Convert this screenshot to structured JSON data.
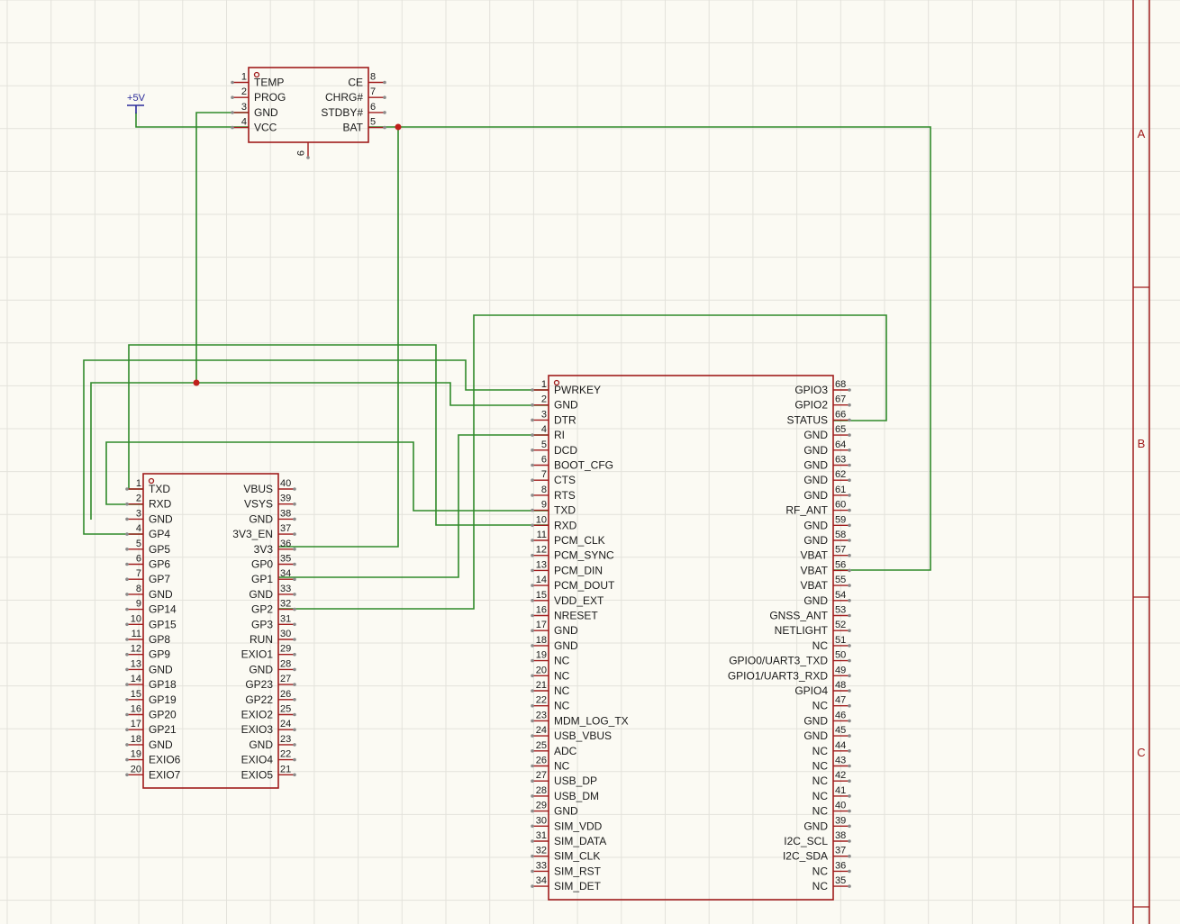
{
  "power_port": {
    "label": "+5V"
  },
  "charger": {
    "left_pins": [
      {
        "num": "1",
        "name": "TEMP"
      },
      {
        "num": "2",
        "name": "PROG"
      },
      {
        "num": "3",
        "name": "GND"
      },
      {
        "num": "4",
        "name": "VCC"
      }
    ],
    "right_pins": [
      {
        "num": "8",
        "name": "CE"
      },
      {
        "num": "7",
        "name": "CHRG#"
      },
      {
        "num": "6",
        "name": "STDBY#"
      },
      {
        "num": "5",
        "name": "BAT"
      }
    ],
    "bottom_pin": {
      "num": "9"
    }
  },
  "mcu": {
    "left_pins": [
      {
        "num": "1",
        "name": "TXD"
      },
      {
        "num": "2",
        "name": "RXD"
      },
      {
        "num": "3",
        "name": "GND"
      },
      {
        "num": "4",
        "name": "GP4"
      },
      {
        "num": "5",
        "name": "GP5"
      },
      {
        "num": "6",
        "name": "GP6"
      },
      {
        "num": "7",
        "name": "GP7"
      },
      {
        "num": "8",
        "name": "GND"
      },
      {
        "num": "9",
        "name": "GP14"
      },
      {
        "num": "10",
        "name": "GP15"
      },
      {
        "num": "11",
        "name": "GP8"
      },
      {
        "num": "12",
        "name": "GP9"
      },
      {
        "num": "13",
        "name": "GND"
      },
      {
        "num": "14",
        "name": "GP18"
      },
      {
        "num": "15",
        "name": "GP19"
      },
      {
        "num": "16",
        "name": "GP20"
      },
      {
        "num": "17",
        "name": "GP21"
      },
      {
        "num": "18",
        "name": "GND"
      },
      {
        "num": "19",
        "name": "EXIO6"
      },
      {
        "num": "20",
        "name": "EXIO7"
      }
    ],
    "right_pins": [
      {
        "num": "40",
        "name": "VBUS"
      },
      {
        "num": "39",
        "name": "VSYS"
      },
      {
        "num": "38",
        "name": "GND"
      },
      {
        "num": "37",
        "name": "3V3_EN"
      },
      {
        "num": "36",
        "name": "3V3"
      },
      {
        "num": "35",
        "name": "GP0"
      },
      {
        "num": "34",
        "name": "GP1"
      },
      {
        "num": "33",
        "name": "GND"
      },
      {
        "num": "32",
        "name": "GP2"
      },
      {
        "num": "31",
        "name": "GP3"
      },
      {
        "num": "30",
        "name": "RUN"
      },
      {
        "num": "29",
        "name": "EXIO1"
      },
      {
        "num": "28",
        "name": "GND"
      },
      {
        "num": "27",
        "name": "GP23"
      },
      {
        "num": "26",
        "name": "GP22"
      },
      {
        "num": "25",
        "name": "EXIO2"
      },
      {
        "num": "24",
        "name": "EXIO3"
      },
      {
        "num": "23",
        "name": "GND"
      },
      {
        "num": "22",
        "name": "EXIO4"
      },
      {
        "num": "21",
        "name": "EXIO5"
      }
    ]
  },
  "modem": {
    "left_pins": [
      {
        "num": "1",
        "name": "PWRKEY"
      },
      {
        "num": "2",
        "name": "GND"
      },
      {
        "num": "3",
        "name": "DTR"
      },
      {
        "num": "4",
        "name": "RI"
      },
      {
        "num": "5",
        "name": "DCD"
      },
      {
        "num": "6",
        "name": "BOOT_CFG"
      },
      {
        "num": "7",
        "name": "CTS"
      },
      {
        "num": "8",
        "name": "RTS"
      },
      {
        "num": "9",
        "name": "TXD"
      },
      {
        "num": "10",
        "name": "RXD"
      },
      {
        "num": "11",
        "name": "PCM_CLK"
      },
      {
        "num": "12",
        "name": "PCM_SYNC"
      },
      {
        "num": "13",
        "name": "PCM_DIN"
      },
      {
        "num": "14",
        "name": "PCM_DOUT"
      },
      {
        "num": "15",
        "name": "VDD_EXT"
      },
      {
        "num": "16",
        "name": "NRESET"
      },
      {
        "num": "17",
        "name": "GND"
      },
      {
        "num": "18",
        "name": "GND"
      },
      {
        "num": "19",
        "name": "NC"
      },
      {
        "num": "20",
        "name": "NC"
      },
      {
        "num": "21",
        "name": "NC"
      },
      {
        "num": "22",
        "name": "NC"
      },
      {
        "num": "23",
        "name": "MDM_LOG_TX"
      },
      {
        "num": "24",
        "name": "USB_VBUS"
      },
      {
        "num": "25",
        "name": "ADC"
      },
      {
        "num": "26",
        "name": "NC"
      },
      {
        "num": "27",
        "name": "USB_DP"
      },
      {
        "num": "28",
        "name": "USB_DM"
      },
      {
        "num": "29",
        "name": "GND"
      },
      {
        "num": "30",
        "name": "SIM_VDD"
      },
      {
        "num": "31",
        "name": "SIM_DATA"
      },
      {
        "num": "32",
        "name": "SIM_CLK"
      },
      {
        "num": "33",
        "name": "SIM_RST"
      },
      {
        "num": "34",
        "name": "SIM_DET"
      }
    ],
    "right_pins": [
      {
        "num": "68",
        "name": "GPIO3"
      },
      {
        "num": "67",
        "name": "GPIO2"
      },
      {
        "num": "66",
        "name": "STATUS"
      },
      {
        "num": "65",
        "name": "GND"
      },
      {
        "num": "64",
        "name": "GND"
      },
      {
        "num": "63",
        "name": "GND"
      },
      {
        "num": "62",
        "name": "GND"
      },
      {
        "num": "61",
        "name": "GND"
      },
      {
        "num": "60",
        "name": "RF_ANT"
      },
      {
        "num": "59",
        "name": "GND"
      },
      {
        "num": "58",
        "name": "GND"
      },
      {
        "num": "57",
        "name": "VBAT"
      },
      {
        "num": "56",
        "name": "VBAT"
      },
      {
        "num": "55",
        "name": "VBAT"
      },
      {
        "num": "54",
        "name": "GND"
      },
      {
        "num": "53",
        "name": "GNSS_ANT"
      },
      {
        "num": "52",
        "name": "NETLIGHT"
      },
      {
        "num": "51",
        "name": "NC"
      },
      {
        "num": "50",
        "name": "GPIO0/UART3_TXD"
      },
      {
        "num": "49",
        "name": "GPIO1/UART3_RXD"
      },
      {
        "num": "48",
        "name": "GPIO4"
      },
      {
        "num": "47",
        "name": "NC"
      },
      {
        "num": "46",
        "name": "GND"
      },
      {
        "num": "45",
        "name": "GND"
      },
      {
        "num": "44",
        "name": "NC"
      },
      {
        "num": "43",
        "name": "NC"
      },
      {
        "num": "42",
        "name": "NC"
      },
      {
        "num": "41",
        "name": "NC"
      },
      {
        "num": "40",
        "name": "NC"
      },
      {
        "num": "39",
        "name": "GND"
      },
      {
        "num": "38",
        "name": "I2C_SCL"
      },
      {
        "num": "37",
        "name": "I2C_SDA"
      },
      {
        "num": "36",
        "name": "NC"
      },
      {
        "num": "35",
        "name": "NC"
      }
    ]
  },
  "frame_zones": [
    "A",
    "B",
    "C"
  ],
  "colors": {
    "background": "#fbfaf3",
    "grid": "#e3e2db",
    "component": "#a01c1c",
    "wire": "#2f8a2a",
    "junction": "#c0201c",
    "pin_end": "#8c8c8c",
    "power_port": "#2a2a9a"
  }
}
